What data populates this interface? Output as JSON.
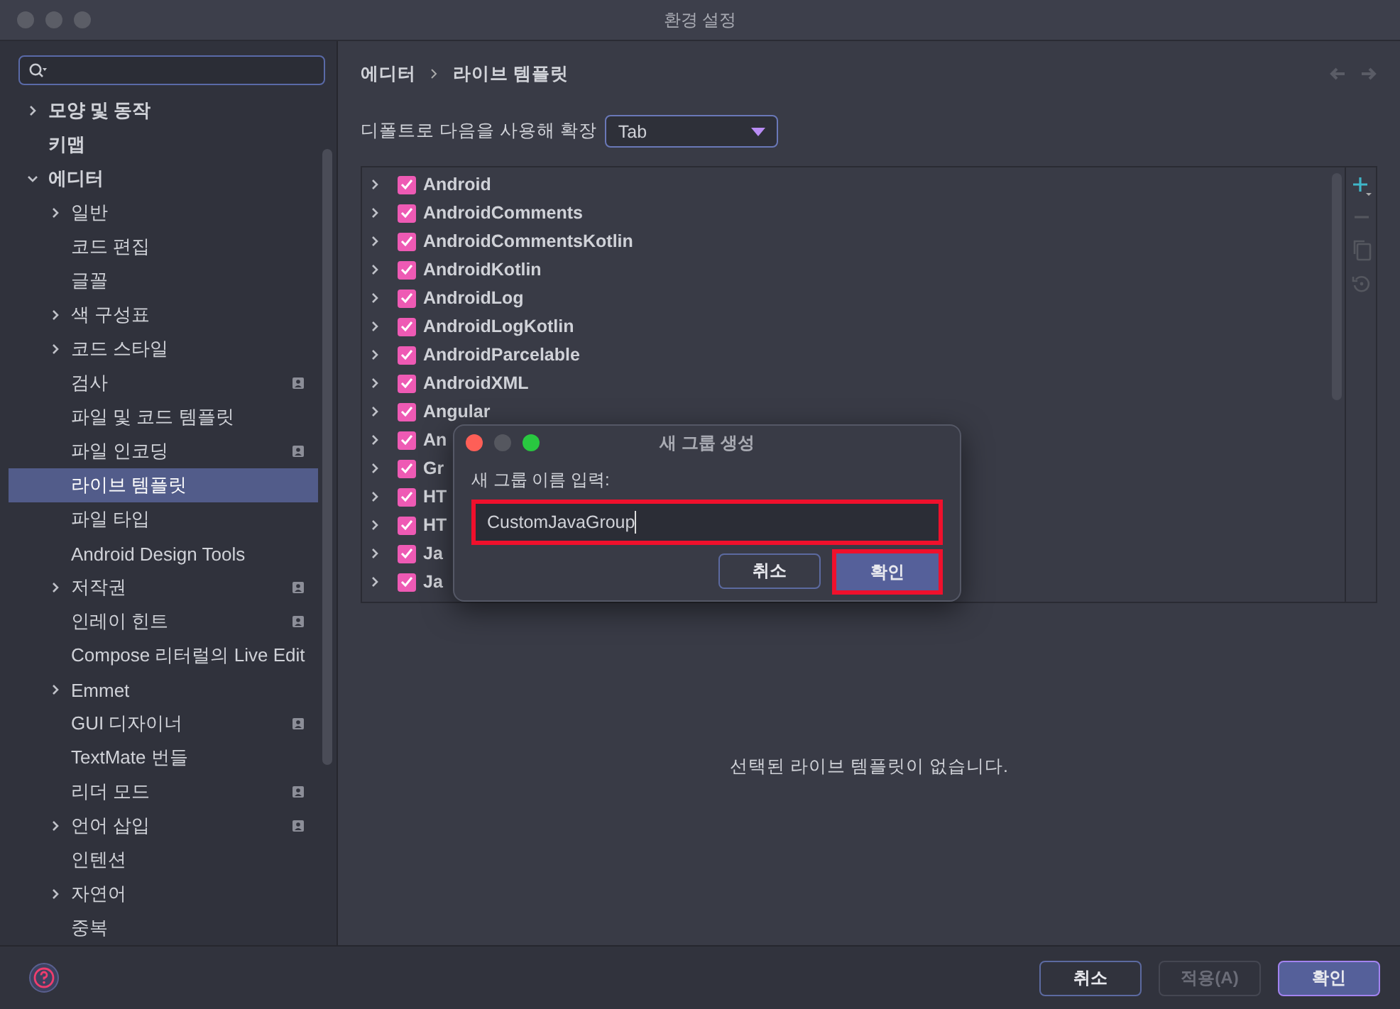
{
  "window": {
    "title": "환경 설정"
  },
  "sidebar": {
    "items": [
      {
        "label": "모양 및 동작",
        "expanded": false,
        "selected": false
      },
      {
        "label": "키맵",
        "selected": false
      },
      {
        "label": "에디터",
        "expanded": true,
        "selected": false,
        "children": [
          {
            "label": "일반",
            "expanded": false,
            "selected": false
          },
          {
            "label": "코드 편집",
            "selected": false
          },
          {
            "label": "글꼴",
            "selected": false
          },
          {
            "label": "색 구성표",
            "expanded": false,
            "selected": false
          },
          {
            "label": "코드 스타일",
            "expanded": false,
            "selected": false
          },
          {
            "label": "검사",
            "selected": false,
            "project_badge": true
          },
          {
            "label": "파일 및 코드 템플릿",
            "selected": false
          },
          {
            "label": "파일 인코딩",
            "selected": false,
            "project_badge": true
          },
          {
            "label": "라이브 템플릿",
            "selected": true
          },
          {
            "label": "파일 타입",
            "selected": false
          },
          {
            "label": "Android Design Tools",
            "selected": false
          },
          {
            "label": "저작권",
            "expanded": false,
            "selected": false,
            "project_badge": true
          },
          {
            "label": "인레이 힌트",
            "selected": false,
            "project_badge": true
          },
          {
            "label": "Compose 리터럴의 Live Edit",
            "selected": false
          },
          {
            "label": "Emmet",
            "expanded": false,
            "selected": false
          },
          {
            "label": "GUI 디자이너",
            "selected": false,
            "project_badge": true
          },
          {
            "label": "TextMate 번들",
            "selected": false
          },
          {
            "label": "리더 모드",
            "selected": false,
            "project_badge": true
          },
          {
            "label": "언어 삽입",
            "expanded": false,
            "selected": false,
            "project_badge": true
          },
          {
            "label": "인텐션",
            "selected": false
          },
          {
            "label": "자연어",
            "expanded": false,
            "selected": false
          },
          {
            "label": "중복",
            "selected": false
          }
        ]
      }
    ]
  },
  "breadcrumb": [
    "에디터",
    "라이브 템플릿"
  ],
  "expand_with": {
    "label": "디폴트로 다음을 사용해 확장",
    "value": "Tab"
  },
  "template_groups": [
    {
      "name": "Android",
      "checked": true
    },
    {
      "name": "AndroidComments",
      "checked": true
    },
    {
      "name": "AndroidCommentsKotlin",
      "checked": true
    },
    {
      "name": "AndroidKotlin",
      "checked": true
    },
    {
      "name": "AndroidLog",
      "checked": true
    },
    {
      "name": "AndroidLogKotlin",
      "checked": true
    },
    {
      "name": "AndroidParcelable",
      "checked": true
    },
    {
      "name": "AndroidXML",
      "checked": true
    },
    {
      "name": "Angular",
      "checked": true
    },
    {
      "name": "An",
      "checked": true
    },
    {
      "name": "Gr",
      "checked": true
    },
    {
      "name": "HT",
      "checked": true
    },
    {
      "name": "HT",
      "checked": true
    },
    {
      "name": "Ja",
      "checked": true
    },
    {
      "name": "Ja",
      "checked": true
    }
  ],
  "empty_message": "선택된 라이브 템플릿이 없습니다.",
  "dialog": {
    "title": "새 그룹 생성",
    "field_label": "새 그룹 이름 입력:",
    "value": "CustomJavaGroup",
    "highlighted": true,
    "buttons": [
      {
        "label": "취소",
        "primary": false,
        "highlighted": false
      },
      {
        "label": "확인",
        "primary": true,
        "highlighted": true
      }
    ]
  },
  "footer": {
    "buttons": [
      {
        "label": "취소",
        "primary": false,
        "disabled": false
      },
      {
        "label": "적용(A)",
        "primary": false,
        "disabled": true
      },
      {
        "label": "확인",
        "primary": true,
        "disabled": false
      }
    ]
  }
}
